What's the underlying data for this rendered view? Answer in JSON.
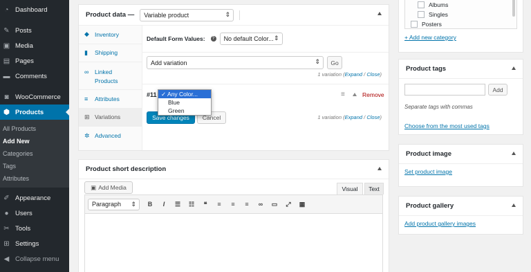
{
  "sidebar": {
    "items": [
      {
        "label": "Dashboard",
        "icon": "dashboard-icon"
      },
      {
        "label": "Posts",
        "icon": "pin-icon"
      },
      {
        "label": "Media",
        "icon": "media-icon"
      },
      {
        "label": "Pages",
        "icon": "pages-icon"
      },
      {
        "label": "Comments",
        "icon": "comments-icon"
      },
      {
        "label": "WooCommerce",
        "icon": "woocommerce-icon"
      },
      {
        "label": "Products",
        "icon": "products-icon"
      }
    ],
    "submenu": [
      "All Products",
      "Add New",
      "Categories",
      "Tags",
      "Attributes"
    ],
    "bottom_items": [
      {
        "label": "Appearance",
        "icon": "appearance-icon"
      },
      {
        "label": "Users",
        "icon": "users-icon"
      },
      {
        "label": "Tools",
        "icon": "tools-icon"
      },
      {
        "label": "Settings",
        "icon": "settings-icon"
      },
      {
        "label": "Collapse menu",
        "icon": "collapse-icon"
      }
    ]
  },
  "product_data": {
    "title": "Product data —",
    "type_value": "Variable product",
    "tabs": [
      "Inventory",
      "Shipping",
      "Linked Products",
      "Attributes",
      "Variations",
      "Advanced"
    ],
    "default_form_label": "Default Form Values:",
    "default_form_value": "No default Color...",
    "add_variation_value": "Add variation",
    "go_label": "Go",
    "variation_count": "1 variation (",
    "expand": "Expand",
    "slash": " / ",
    "close": "Close",
    "paren": ")",
    "variation_id": "#11",
    "remove": "Remove",
    "save_label": "Save changes",
    "cancel_label": "Cancel",
    "color_options": [
      "Any Color...",
      "Blue",
      "Green"
    ],
    "selected_check": "✓"
  },
  "short_desc": {
    "title": "Product short description",
    "add_media": "Add Media",
    "tab_visual": "Visual",
    "tab_text": "Text",
    "format_value": "Paragraph"
  },
  "categories": {
    "items": [
      "Albums",
      "Singles",
      "Posters"
    ],
    "add_new": "+ Add new category"
  },
  "tags": {
    "title": "Product tags",
    "add_label": "Add",
    "hint": "Separate tags with commas",
    "choose_link": "Choose from the most used tags"
  },
  "image": {
    "title": "Product image",
    "link": "Set product image"
  },
  "gallery": {
    "title": "Product gallery",
    "link": "Add product gallery images"
  }
}
